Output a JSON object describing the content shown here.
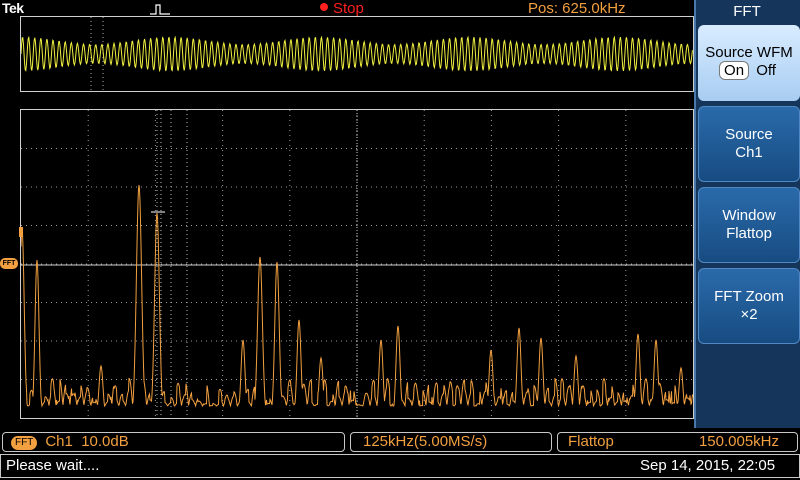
{
  "brand": "Tek",
  "acquisition": {
    "state": "Stop",
    "state_color": "#ff2020"
  },
  "position": "Pos: 625.0kHz",
  "fft_marker_label": "FFT",
  "menu": {
    "title": "FFT",
    "buttons": [
      {
        "line1": "Source WFM",
        "on": "On",
        "off": "Off"
      },
      {
        "line1": "Source",
        "line2": "Ch1"
      },
      {
        "line1": "Window",
        "line2": "Flattop"
      },
      {
        "line1": "FFT Zoom",
        "line2": "×2"
      }
    ]
  },
  "status": {
    "fft_badge": "FFT",
    "channel": "Ch1",
    "scale": "10.0dB",
    "span": "125kHz(5.00MS/s)",
    "window": "Flattop",
    "frequency": "150.005kHz"
  },
  "message": "Please wait....",
  "datetime": "Sep 14, 2015, 22:05",
  "colors": {
    "trace": "#f2a040",
    "overview_trace": "#f0f040",
    "grid": "#9a9a9a",
    "menu_bg": "#15355a"
  }
}
